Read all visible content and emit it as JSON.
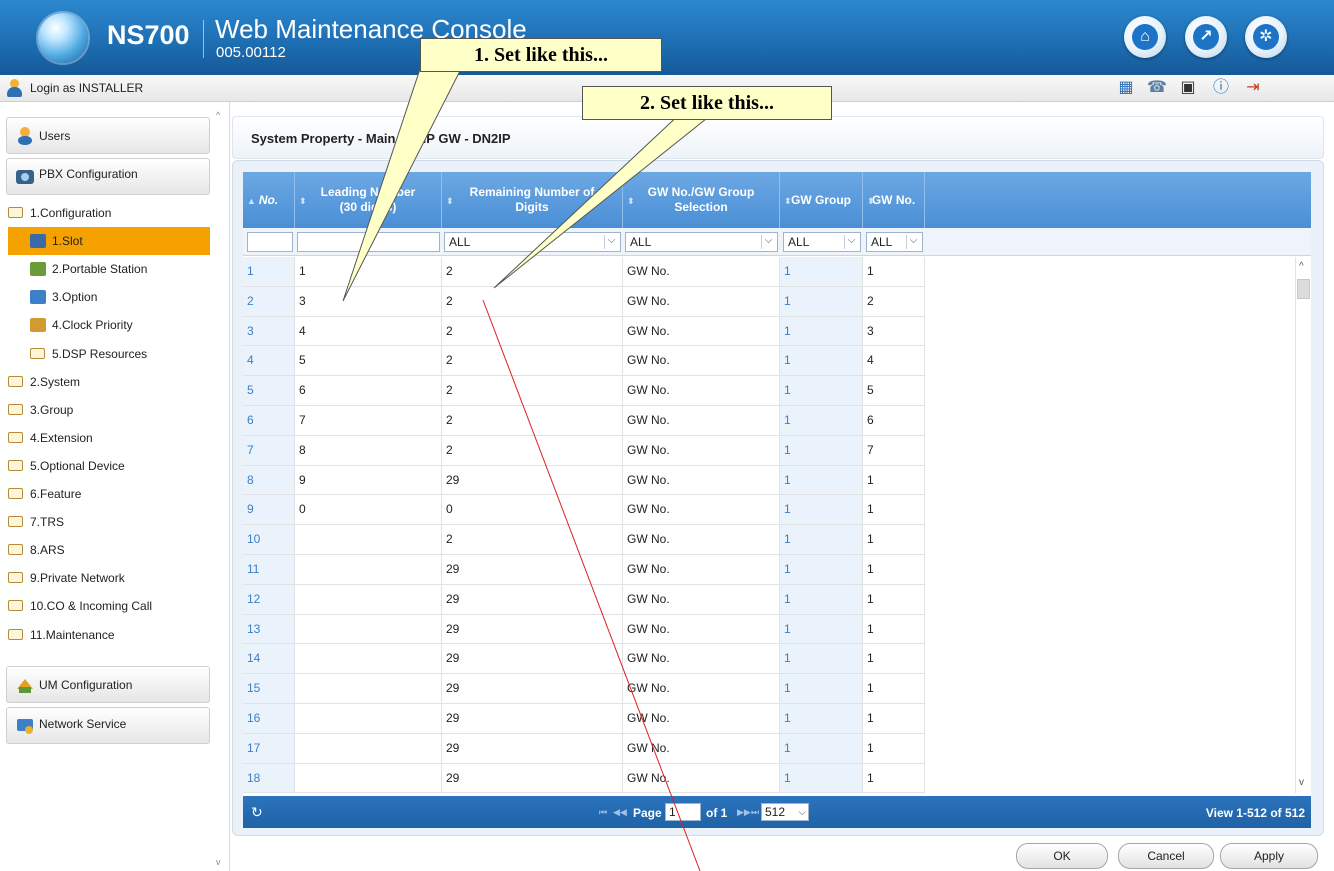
{
  "header": {
    "brand": "NS700",
    "console_title": "Web Maintenance Console",
    "version": "005.00112",
    "icons": [
      "home-icon",
      "wrench-icon",
      "gear-icon"
    ]
  },
  "loginbar": {
    "text": "Login as INSTALLER",
    "tools": [
      "calendar-icon",
      "phone-icon",
      "save-icon",
      "info-icon",
      "logout-icon"
    ]
  },
  "sidebar": {
    "users": "Users",
    "pbx": "PBX Configuration",
    "items": [
      {
        "label": "1.Configuration",
        "type": "folder",
        "indent": 0
      },
      {
        "label": "1.Slot",
        "type": "slot",
        "indent": 1,
        "active": true
      },
      {
        "label": "2.Portable Station",
        "type": "portable",
        "indent": 1
      },
      {
        "label": "3.Option",
        "type": "option",
        "indent": 1
      },
      {
        "label": "4.Clock Priority",
        "type": "clock",
        "indent": 1
      },
      {
        "label": "5.DSP Resources",
        "type": "folder",
        "indent": 1
      },
      {
        "label": "2.System",
        "type": "folder",
        "indent": 0
      },
      {
        "label": "3.Group",
        "type": "folder",
        "indent": 0
      },
      {
        "label": "4.Extension",
        "type": "folder",
        "indent": 0
      },
      {
        "label": "5.Optional Device",
        "type": "folder",
        "indent": 0
      },
      {
        "label": "6.Feature",
        "type": "folder",
        "indent": 0
      },
      {
        "label": "7.TRS",
        "type": "folder",
        "indent": 0
      },
      {
        "label": "8.ARS",
        "type": "folder",
        "indent": 0
      },
      {
        "label": "9.Private Network",
        "type": "folder",
        "indent": 0
      },
      {
        "label": "10.CO & Incoming Call",
        "type": "folder",
        "indent": 0
      },
      {
        "label": "11.Maintenance",
        "type": "folder",
        "indent": 0
      }
    ],
    "um": "UM Configuration",
    "network": "Network Service"
  },
  "content": {
    "title": "System Property - Main - VoIP GW - DN2IP"
  },
  "table": {
    "headers": {
      "no": "No.",
      "leading": "Leading Number\n(30 digits)",
      "remaining": "Remaining Number of\nDigits",
      "selection": "GW No./GW Group\nSelection",
      "group": "GW Group",
      "gwno": "GW No."
    },
    "filters": {
      "remaining": "ALL",
      "selection": "ALL",
      "group": "ALL",
      "gwno": "ALL"
    },
    "rows": [
      {
        "no": "1",
        "leading": "1",
        "remaining": "2",
        "selection": "GW No.",
        "group": "1",
        "gwno": "1"
      },
      {
        "no": "2",
        "leading": "3",
        "remaining": "2",
        "selection": "GW No.",
        "group": "1",
        "gwno": "2"
      },
      {
        "no": "3",
        "leading": "4",
        "remaining": "2",
        "selection": "GW No.",
        "group": "1",
        "gwno": "3"
      },
      {
        "no": "4",
        "leading": "5",
        "remaining": "2",
        "selection": "GW No.",
        "group": "1",
        "gwno": "4"
      },
      {
        "no": "5",
        "leading": "6",
        "remaining": "2",
        "selection": "GW No.",
        "group": "1",
        "gwno": "5"
      },
      {
        "no": "6",
        "leading": "7",
        "remaining": "2",
        "selection": "GW No.",
        "group": "1",
        "gwno": "6"
      },
      {
        "no": "7",
        "leading": "8",
        "remaining": "2",
        "selection": "GW No.",
        "group": "1",
        "gwno": "7"
      },
      {
        "no": "8",
        "leading": "9",
        "remaining": "29",
        "selection": "GW No.",
        "group": "1",
        "gwno": "1"
      },
      {
        "no": "9",
        "leading": "0",
        "remaining": "0",
        "selection": "GW No.",
        "group": "1",
        "gwno": "1"
      },
      {
        "no": "10",
        "leading": "",
        "remaining": "2",
        "selection": "GW No.",
        "group": "1",
        "gwno": "1"
      },
      {
        "no": "11",
        "leading": "",
        "remaining": "29",
        "selection": "GW No.",
        "group": "1",
        "gwno": "1"
      },
      {
        "no": "12",
        "leading": "",
        "remaining": "29",
        "selection": "GW No.",
        "group": "1",
        "gwno": "1"
      },
      {
        "no": "13",
        "leading": "",
        "remaining": "29",
        "selection": "GW No.",
        "group": "1",
        "gwno": "1"
      },
      {
        "no": "14",
        "leading": "",
        "remaining": "29",
        "selection": "GW No.",
        "group": "1",
        "gwno": "1"
      },
      {
        "no": "15",
        "leading": "",
        "remaining": "29",
        "selection": "GW No.",
        "group": "1",
        "gwno": "1"
      },
      {
        "no": "16",
        "leading": "",
        "remaining": "29",
        "selection": "GW No.",
        "group": "1",
        "gwno": "1"
      },
      {
        "no": "17",
        "leading": "",
        "remaining": "29",
        "selection": "GW No.",
        "group": "1",
        "gwno": "1"
      },
      {
        "no": "18",
        "leading": "",
        "remaining": "29",
        "selection": "GW No.",
        "group": "1",
        "gwno": "1"
      }
    ]
  },
  "pager": {
    "page_label": "Page",
    "page_value": "1",
    "of_label": "of 1",
    "per_page": "512",
    "view": "View 1-512 of 512"
  },
  "buttons": {
    "ok": "OK",
    "cancel": "Cancel",
    "apply": "Apply"
  },
  "annotations": {
    "callout1": "1. Set like this...",
    "callout2": "2. Set like this..."
  }
}
